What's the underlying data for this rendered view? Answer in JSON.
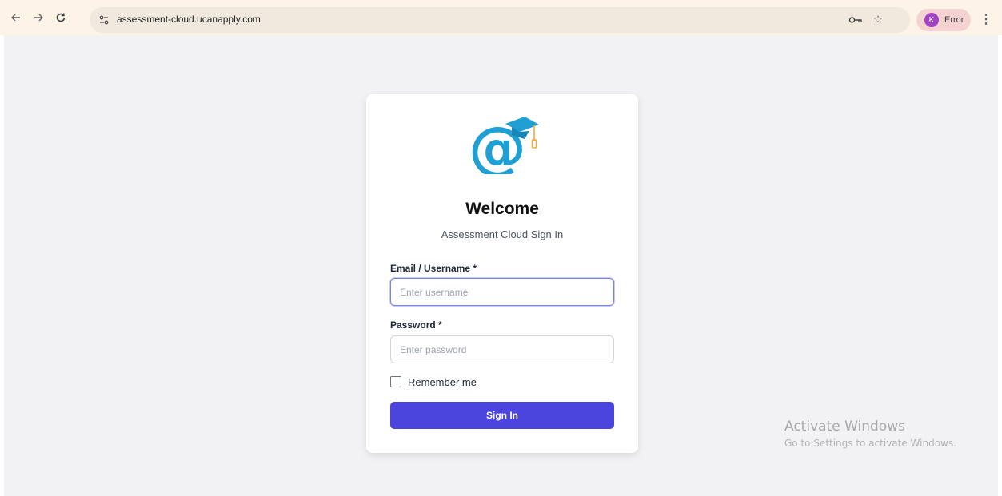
{
  "browser": {
    "url": "assessment-cloud.ucanapply.com",
    "profile": {
      "initial": "K",
      "status": "Error"
    },
    "icons": {
      "back": "back-arrow-icon",
      "forward": "forward-arrow-icon",
      "reload": "reload-icon",
      "site_info": "site-info-icon",
      "password": "password-key-icon",
      "bookmark": "bookmark-star-icon",
      "menu": "kebab-menu-icon"
    }
  },
  "login": {
    "title": "Welcome",
    "subtitle": "Assessment Cloud Sign In",
    "username_label": "Email / Username *",
    "username_placeholder": "Enter username",
    "password_label": "Password *",
    "password_placeholder": "Enter password",
    "remember_label": "Remember me",
    "submit_label": "Sign In"
  },
  "watermark": {
    "title": "Activate Windows",
    "subtitle": "Go to Settings to activate Windows."
  },
  "colors": {
    "accent": "#4b44dd",
    "logo_blue": "#1f9fd4",
    "logo_tassel": "#f0a830",
    "page_bg": "#f2f2f5",
    "toolbar_bg": "#fdf3e7"
  }
}
